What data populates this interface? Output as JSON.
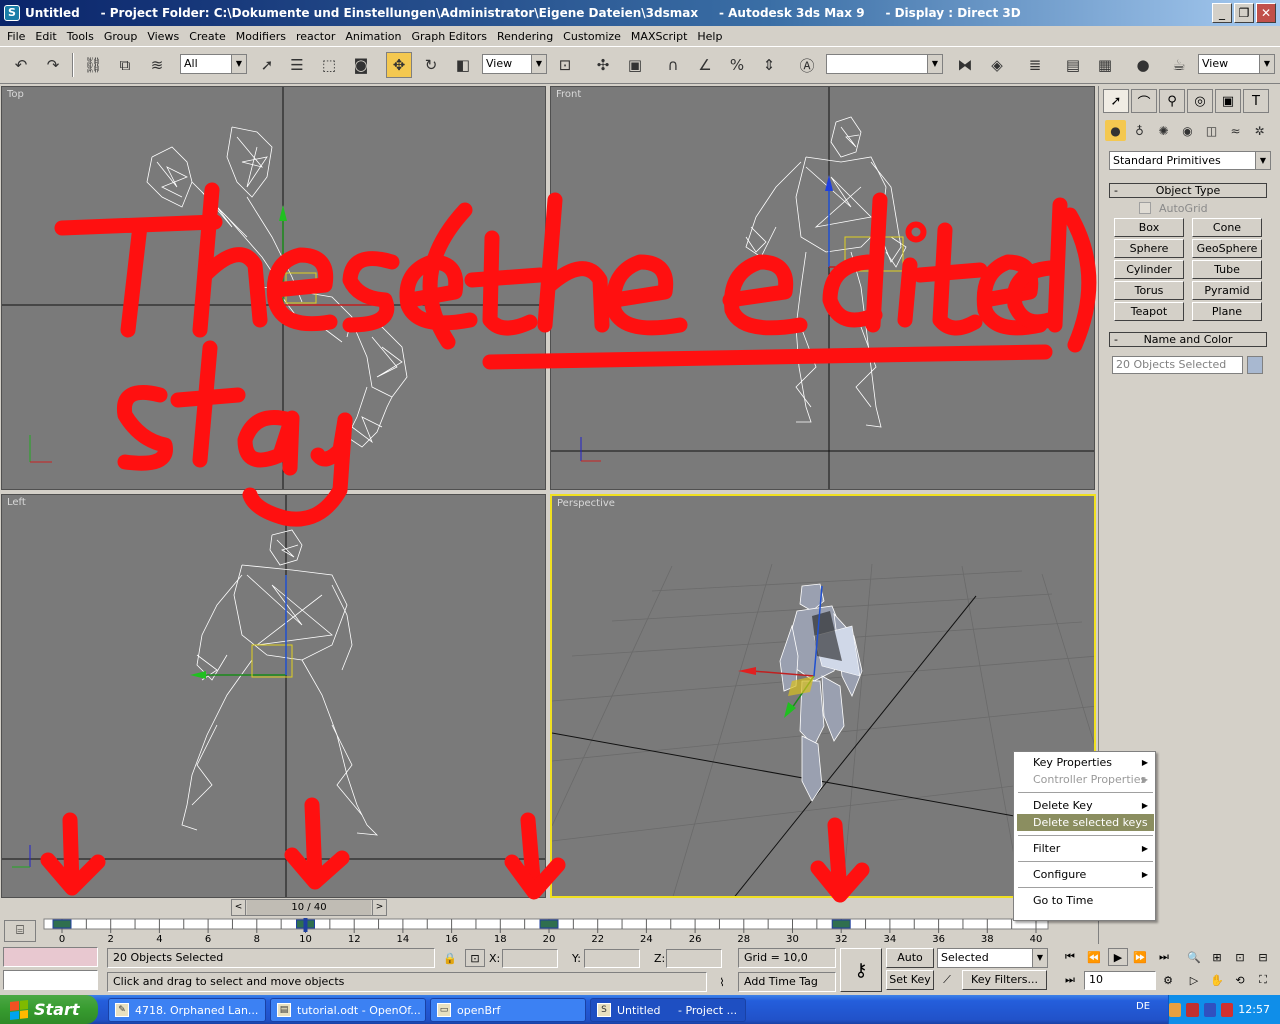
{
  "window": {
    "title": "Untitled     - Project Folder: C:\\Dokumente und Einstellungen\\Administrator\\Eigene Dateien\\3dsmax     - Autodesk 3ds Max 9     - Display : Direct 3D",
    "app_icon": "3dsmax-icon"
  },
  "menu": [
    "File",
    "Edit",
    "Tools",
    "Group",
    "Views",
    "Create",
    "Modifiers",
    "reactor",
    "Animation",
    "Graph Editors",
    "Rendering",
    "Customize",
    "MAXScript",
    "Help"
  ],
  "toolbar": {
    "selection_filter": "All",
    "ref_coord_1": "View",
    "ref_coord_2": "View",
    "named_selection": ""
  },
  "viewports": {
    "top": "Top",
    "front": "Front",
    "left": "Left",
    "perspective": "Perspective"
  },
  "command_panel": {
    "category": "Standard Primitives",
    "object_type_title": "Object Type",
    "autogrid": "AutoGrid",
    "primitives": [
      "Box",
      "Cone",
      "Sphere",
      "GeoSphere",
      "Cylinder",
      "Tube",
      "Torus",
      "Pyramid",
      "Teapot",
      "Plane"
    ],
    "name_color_title": "Name and Color",
    "name_value": "20 Objects Selected",
    "swatch_color": "#a8b8d0"
  },
  "timeline": {
    "slider_label": "10 / 40",
    "ticks": [
      "0",
      "2",
      "4",
      "6",
      "8",
      "10",
      "12",
      "14",
      "16",
      "18",
      "20",
      "22",
      "24",
      "26",
      "28",
      "30",
      "32",
      "34",
      "36",
      "38",
      "40"
    ],
    "current_frame": 10,
    "keys": [
      0,
      10,
      20,
      32
    ]
  },
  "status": {
    "selection_info": "20 Objects Selected",
    "prompt": "Click and drag to select and move objects",
    "x_label": "X:",
    "y_label": "Y:",
    "z_label": "Z:",
    "grid": "Grid = 10,0",
    "add_time_tag": "Add Time Tag",
    "auto_key": "Auto Key",
    "set_key": "Set Key",
    "key_mode": "Selected",
    "key_filters": "Key Filters...",
    "frame_field": "10"
  },
  "context_menu": {
    "items": [
      {
        "label": "Key Properties",
        "sub": true,
        "disabled": false
      },
      {
        "label": "Controller Properties",
        "sub": true,
        "disabled": true
      },
      {
        "label": "Delete Key",
        "sub": true,
        "disabled": false
      },
      {
        "label": "Delete selected keys",
        "sub": false,
        "highlight": true
      },
      {
        "label": "Filter",
        "sub": true,
        "disabled": false
      },
      {
        "label": "Configure",
        "sub": true,
        "disabled": false
      },
      {
        "label": "Go to Time",
        "sub": false,
        "disabled": false
      }
    ]
  },
  "annotation": {
    "line1": "These ( the edited )",
    "line2": "stay",
    "color": "#ff0000"
  },
  "taskbar": {
    "start": "Start",
    "tasks": [
      "4718. Orphaned Lan...",
      "tutorial.odt - OpenOf...",
      "openBrf",
      "Untitled     - Project ..."
    ],
    "language": "DE",
    "clock": "12:57"
  }
}
